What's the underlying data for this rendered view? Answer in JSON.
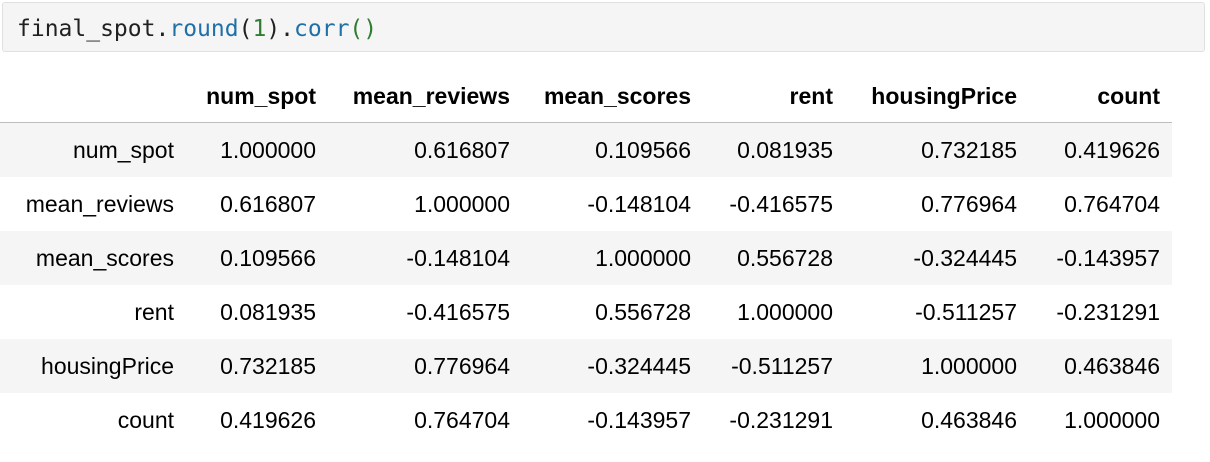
{
  "code_cell": {
    "tokens": {
      "obj": "final_spot",
      "dot1": ".",
      "method1": "round",
      "paren_open1": "(",
      "arg": "1",
      "paren_close1": ")",
      "dot2": ".",
      "method2": "corr",
      "call_parens": "()"
    }
  },
  "table": {
    "columns": [
      "num_spot",
      "mean_reviews",
      "mean_scores",
      "rent",
      "housingPrice",
      "count"
    ],
    "rows": [
      {
        "index": "num_spot",
        "values": [
          "1.000000",
          "0.616807",
          "0.109566",
          "0.081935",
          "0.732185",
          "0.419626"
        ]
      },
      {
        "index": "mean_reviews",
        "values": [
          "0.616807",
          "1.000000",
          "-0.148104",
          "-0.416575",
          "0.776964",
          "0.764704"
        ]
      },
      {
        "index": "mean_scores",
        "values": [
          "0.109566",
          "-0.148104",
          "1.000000",
          "0.556728",
          "-0.324445",
          "-0.143957"
        ]
      },
      {
        "index": "rent",
        "values": [
          "0.081935",
          "-0.416575",
          "0.556728",
          "1.000000",
          "-0.511257",
          "-0.231291"
        ]
      },
      {
        "index": "housingPrice",
        "values": [
          "0.732185",
          "0.776964",
          "-0.324445",
          "-0.511257",
          "1.000000",
          "0.463846"
        ]
      },
      {
        "index": "count",
        "values": [
          "0.419626",
          "0.764704",
          "-0.143957",
          "-0.231291",
          "0.463846",
          "1.000000"
        ]
      }
    ]
  },
  "colors": {
    "code_bg": "#f5f5f5",
    "method": "#1f6fa8",
    "number": "#2e7d32",
    "row_stripe": "#f5f5f5"
  }
}
